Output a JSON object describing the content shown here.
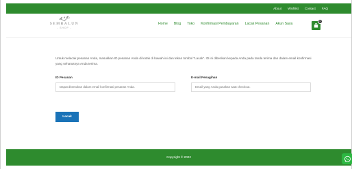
{
  "topbar": {
    "links": [
      "About",
      "Wishlist",
      "Contact",
      "FAQ"
    ]
  },
  "brand": {
    "name": "SEMBALUN",
    "tagline": "- SHOP -"
  },
  "nav": {
    "items": [
      "Home",
      "Blog",
      "Toko",
      "Konfirmasi Pembayaran",
      "Lacak Pesanan",
      "Akun Saya"
    ]
  },
  "cart": {
    "count": "0"
  },
  "tracking": {
    "intro": "Untuk melacak pesanan Anda, masukkan ID pesanan Anda di kotak di bawah ini dan tekan tombol \"Lacak\". ID ini diberikan kepada Anda pada tanda terima dan dalam email konfirmasi yang seharusnya Anda terima.",
    "order_id_label": "ID Pesanan",
    "order_id_placeholder": "Dapat ditemukan dalam email konfirmasi pesanan Anda.",
    "email_label": "E-mail Penagihan",
    "email_placeholder": "Email yang Anda gunakan saat checkout.",
    "submit_label": "Lacak"
  },
  "footer": {
    "copyright": "Copyright © 2022"
  },
  "colors": {
    "brand_green": "#2e8b2e",
    "button_blue": "#1a73b8",
    "whatsapp_green": "#2db742"
  },
  "icons": {
    "cart": "shopping-bag-icon",
    "logo": "leaf-logo-icon",
    "chat": "whatsapp-icon"
  }
}
